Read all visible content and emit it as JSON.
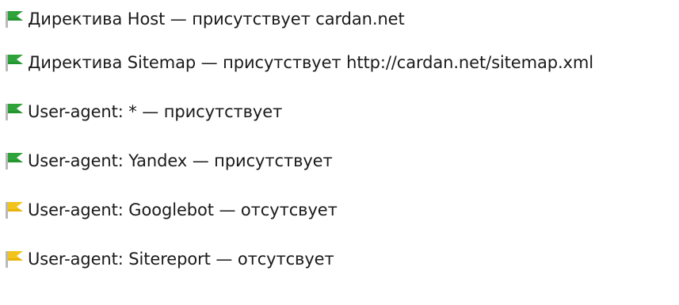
{
  "colors": {
    "ok": "#2ea33a",
    "ok_dark": "#1f8a2c",
    "warn": "#f2c31b",
    "warn_dark": "#e0a800",
    "pole": "#b9b9b9"
  },
  "items": [
    {
      "status": "ok",
      "icon": "green-flag-icon",
      "text": "Директива Host — присутствует cardan.net"
    },
    {
      "status": "ok",
      "icon": "green-flag-icon",
      "text": "Директива Sitemap — присутствует http://cardan.net/sitemap.xml"
    },
    {
      "status": "ok",
      "icon": "green-flag-icon",
      "text": "User-agent: * — присутствует"
    },
    {
      "status": "ok",
      "icon": "green-flag-icon",
      "text": "User-agent: Yandex — присутствует"
    },
    {
      "status": "warn",
      "icon": "yellow-flag-icon",
      "text": "User-agent: Googlebot — отсутсвует"
    },
    {
      "status": "warn",
      "icon": "yellow-flag-icon",
      "text": "User-agent: Sitereport — отсутсвует"
    }
  ]
}
